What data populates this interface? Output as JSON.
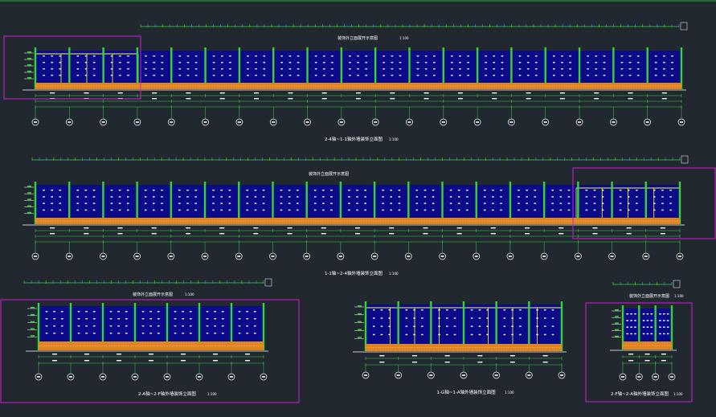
{
  "drawing": {
    "background": "#212830",
    "colors": {
      "wall_fill": "#0b0b8a",
      "slab": "#e0841f",
      "column": "#35d435",
      "grid_line": "#35d435",
      "frame_highlight": "#ffff33",
      "selection_box": "#d21fd2",
      "text": "#ffffff",
      "strip_tick": "#4a7bff"
    },
    "elevations": [
      {
        "id": "elev-1",
        "caption": "2-4轴~1-1轴外墙装饰立面图",
        "scale": "1:100",
        "strip_label": "装饰外立面展开示意图",
        "strip_scale": "1:100",
        "bays": 19
      },
      {
        "id": "elev-2",
        "caption": "1-1轴~2-4轴外墙装饰立面图",
        "scale": "1:100",
        "strip_label": "装饰外立面展开示意图",
        "strip_scale": "",
        "bays": 19
      },
      {
        "id": "elev-3",
        "caption": "2-A轴~2-F轴外墙装饰立面图",
        "scale": "1:100",
        "strip_label": "装饰外立面展开示意图",
        "strip_scale": "1:100",
        "bays": 7
      },
      {
        "id": "elev-4",
        "caption": "1-G轴~1-A轴外墙装饰立面图",
        "scale": "1:100",
        "strip_label": "",
        "strip_scale": "",
        "bays": 6
      },
      {
        "id": "elev-5",
        "caption": "2-F轴~2-A轴外墙装饰立面图",
        "scale": "1:100",
        "strip_label": "装饰外立面展开示意图",
        "strip_scale": "1:100",
        "bays": 3
      }
    ]
  }
}
